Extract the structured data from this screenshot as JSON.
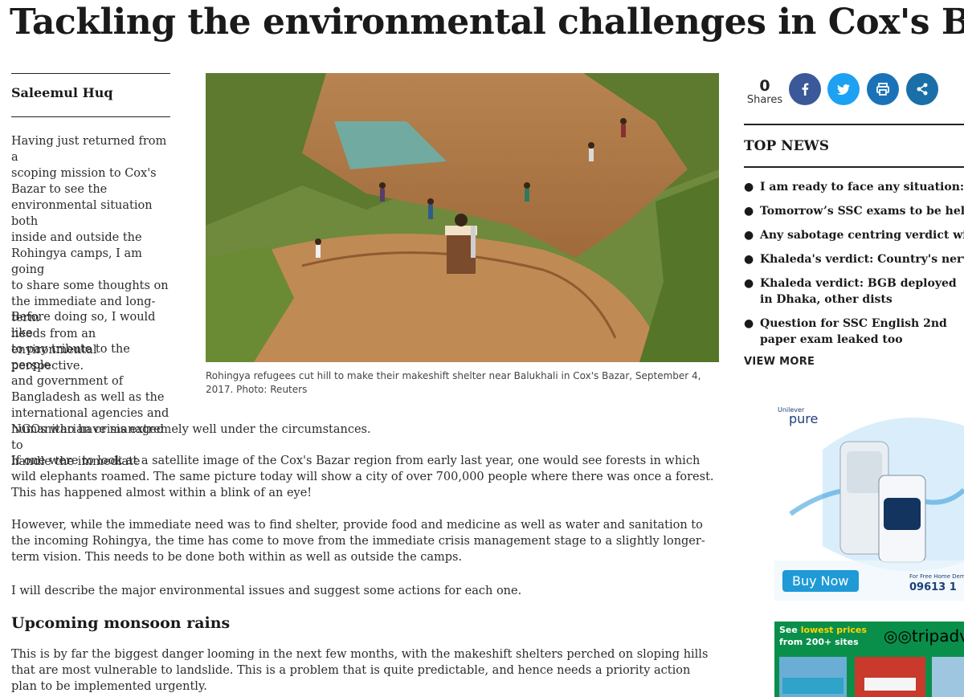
{
  "article": {
    "headline": "Tackling the environmental challenges in Cox's Bazar",
    "author": "Saleemul Huq",
    "intro_lines": [
      "Having just returned from a",
      "scoping mission to Cox's",
      "Bazar to see the",
      "environmental situation both",
      "inside and outside the",
      "Rohingya camps, I am going",
      "to share some thoughts on",
      "the immediate and long-term",
      "needs from an environmental",
      "perspective."
    ],
    "tribute_lines": [
      "Before doing so, I would like",
      "to pay tribute to the people",
      "and government of",
      "Bangladesh as well as the",
      "international agencies and",
      "NGOs who have managed to",
      "handle the immediate"
    ],
    "tribute_tail": "humanitarian crisis extremely well under the circumstances.",
    "para_satellite": "If one were to look at a satellite image of the Cox's Bazar region from early last year, one would see forests in which wild elephants roamed. The same picture today will show a city of over 700,000 people where there was once a forest. This has happened almost within a blink of an eye!",
    "para_however": "However, while the immediate need was to find shelter, provide food and medicine as well as water and sanitation to the incoming Rohingya, the time has come to move from the immediate crisis management stage to a slightly longer-term vision. This needs to be done both within as well as outside the camps.",
    "para_describe": "I will describe the major environmental issues and suggest some actions for each one.",
    "subhead": "Upcoming monsoon rains",
    "para_monsoon": "This is by far the biggest danger looming in the next few months, with the makeshift shelters perched on sloping hills that are most vulnerable to landslide. This is a problem that is quite predictable, and hence needs a priority action plan to be implemented urgently.",
    "caption": "Rohingya refugees cut hill to make their makeshift shelter near Balukhali in Cox's Bazar, September 4, 2017. Photo: Reuters"
  },
  "share": {
    "count": "0",
    "label": "Shares",
    "buttons": [
      {
        "name": "facebook",
        "icon": "facebook-icon",
        "color": "#3b5998"
      },
      {
        "name": "twitter",
        "icon": "twitter-icon",
        "color": "#1da1f2"
      },
      {
        "name": "print",
        "icon": "print-icon",
        "color": "#1a73b8"
      },
      {
        "name": "share",
        "icon": "share-icon",
        "color": "#1a6fa8"
      }
    ]
  },
  "top_news": {
    "title": "TOP NEWS",
    "items": [
      "I am ready to face any situation: Khaleda",
      "Tomorrow’s SSC exams to be held as scheduled",
      "Any sabotage centring verdict will be dealt with",
      "Khaleda's verdict: Country's nerves on edge",
      "Khaleda verdict: BGB deployed in Dhaka, other dists",
      "Question for SSC English 2nd paper exam leaked too"
    ],
    "view_more": "VIEW MORE"
  },
  "ads": {
    "ad1": {
      "brand_top": "Unilever",
      "brand": "pure",
      "button": "Buy Now",
      "note": "For Free Home Demo",
      "phone": "09613 1"
    },
    "ad2": {
      "line1_a": "See ",
      "line1_b": "lowest prices",
      "line2": "from 200+ sites",
      "logo": "tripadvisor"
    }
  },
  "colors": {
    "facebook": "#3b5998",
    "twitter": "#1da1f2",
    "print": "#1a73b8",
    "share": "#1a6fa8",
    "ad_green": "#0a8f4a",
    "tripadvisor_yellow": "#ffd700"
  }
}
